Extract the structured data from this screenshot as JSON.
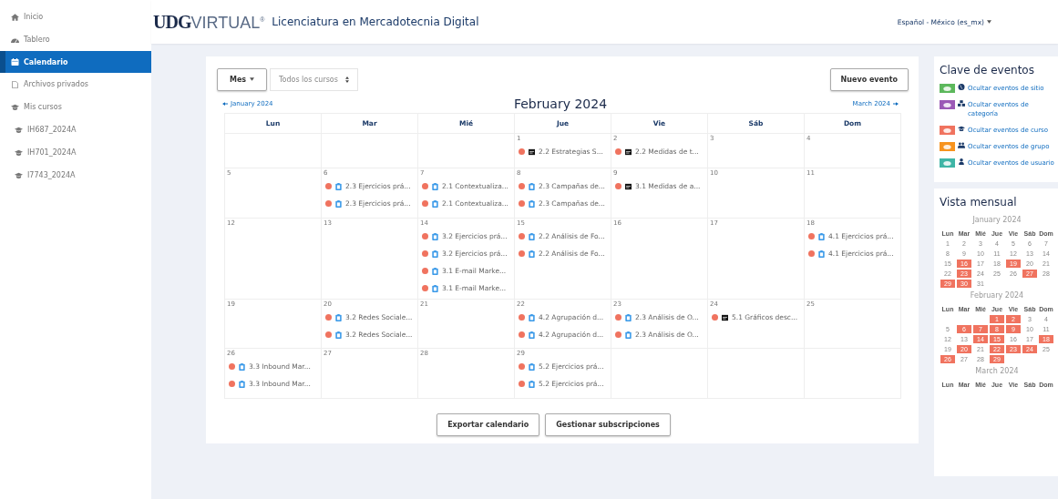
{
  "sidebar": {
    "items": [
      {
        "label": "Inicio",
        "selected": false
      },
      {
        "label": "Tablero",
        "selected": false
      },
      {
        "label": "Calendario",
        "selected": true
      },
      {
        "label": "Archivos privados",
        "selected": false
      },
      {
        "label": "Mis cursos",
        "selected": false,
        "children": [
          {
            "label": "IH687_2024A",
            "selected": false
          },
          {
            "label": "IH701_2024A",
            "selected": false
          },
          {
            "label": "I7743_2024A",
            "selected": false
          }
        ]
      }
    ]
  },
  "header": {
    "logo": "**UDG**VIRTUAL$^{®}$",
    "site_title": "Licenciatura en Mercadotecnia Digital",
    "language": "Español - México (es_mx)"
  },
  "calendar": {
    "view_button": "Mes",
    "course_filter": "Todos los cursos",
    "new_event_button": "Nuevo evento",
    "previous_month": "January 2024",
    "current_month": "February 2024",
    "next_month": "March 2024",
    "weekdays": [
      "Lun",
      "Mar",
      "Mié",
      "Jue",
      "Vie",
      "Sáb",
      "Dom"
    ],
    "weeks": [
      [
        {
          "kind": "blank"
        },
        {
          "kind": "blank"
        },
        {
          "kind": "blank"
        },
        {
          "kind": "day",
          "day": "1",
          "events": [
            {
              "kind": "quiz",
              "title": "2.2 Estrategias S..."
            }
          ]
        },
        {
          "kind": "day",
          "day": "2",
          "events": [
            {
              "kind": "quiz",
              "title": "2.2 Medidas de t..."
            }
          ]
        },
        {
          "kind": "day",
          "day": "3"
        },
        {
          "kind": "day",
          "day": "4"
        }
      ],
      [
        {
          "kind": "day",
          "day": "5"
        },
        {
          "kind": "day",
          "day": "6",
          "events": [
            {
              "kind": "assign",
              "title": "2.3 Ejercicios prá..."
            },
            {
              "kind": "assign",
              "title": "2.3 Ejercicios prá..."
            }
          ]
        },
        {
          "kind": "day",
          "day": "7",
          "events": [
            {
              "kind": "assign",
              "title": "2.1 Contextualiza..."
            },
            {
              "kind": "assign",
              "title": "2.1 Contextualiza..."
            }
          ]
        },
        {
          "kind": "day",
          "day": "8",
          "events": [
            {
              "kind": "assign",
              "title": "2.3 Campañas de..."
            },
            {
              "kind": "assign",
              "title": "2.3 Campañas de..."
            }
          ]
        },
        {
          "kind": "day",
          "day": "9",
          "events": [
            {
              "kind": "quiz",
              "title": "3.1 Medidas de a..."
            }
          ]
        },
        {
          "kind": "day",
          "day": "10"
        },
        {
          "kind": "day",
          "day": "11"
        }
      ],
      [
        {
          "kind": "day",
          "day": "12"
        },
        {
          "kind": "day",
          "day": "13"
        },
        {
          "kind": "day",
          "day": "14",
          "events": [
            {
              "kind": "assign",
              "title": "3.2 Ejercicios prá..."
            },
            {
              "kind": "assign",
              "title": "3.2 Ejercicios prá..."
            },
            {
              "kind": "assign",
              "title": "3.1 E-mail Marke..."
            },
            {
              "kind": "assign",
              "title": "3.1 E-mail Marke..."
            }
          ]
        },
        {
          "kind": "day",
          "day": "15",
          "events": [
            {
              "kind": "assign",
              "title": "2.2 Análisis de Fo..."
            },
            {
              "kind": "assign",
              "title": "2.2 Análisis de Fo..."
            }
          ]
        },
        {
          "kind": "day",
          "day": "16"
        },
        {
          "kind": "day",
          "day": "17"
        },
        {
          "kind": "day",
          "day": "18",
          "events": [
            {
              "kind": "assign",
              "title": "4.1 Ejercicios prá..."
            },
            {
              "kind": "assign",
              "title": "4.1 Ejercicios prá..."
            }
          ]
        }
      ],
      [
        {
          "kind": "day",
          "day": "19"
        },
        {
          "kind": "day",
          "day": "20",
          "events": [
            {
              "kind": "assign",
              "title": "3.2 Redes Sociale..."
            },
            {
              "kind": "assign",
              "title": "3.2 Redes Sociale..."
            }
          ]
        },
        {
          "kind": "day",
          "day": "21"
        },
        {
          "kind": "day",
          "day": "22",
          "events": [
            {
              "kind": "assign",
              "title": "4.2 Agrupación d..."
            },
            {
              "kind": "assign",
              "title": "4.2 Agrupación d..."
            }
          ]
        },
        {
          "kind": "day",
          "day": "23",
          "events": [
            {
              "kind": "assign",
              "title": "2.3 Análisis de O..."
            },
            {
              "kind": "assign",
              "title": "2.3 Análisis de O..."
            }
          ]
        },
        {
          "kind": "day",
          "day": "24",
          "events": [
            {
              "kind": "quiz",
              "title": "5.1 Gráficos desc..."
            }
          ]
        },
        {
          "kind": "day",
          "day": "25"
        }
      ],
      [
        {
          "kind": "day",
          "day": "26",
          "events": [
            {
              "kind": "assign",
              "title": "3.3 Inbound Mar..."
            },
            {
              "kind": "assign",
              "title": "3.3 Inbound Mar..."
            }
          ]
        },
        {
          "kind": "day",
          "day": "27"
        },
        {
          "kind": "day",
          "day": "28"
        },
        {
          "kind": "day",
          "day": "29",
          "events": [
            {
              "kind": "assign",
              "title": "5.2 Ejercicios prá..."
            },
            {
              "kind": "assign",
              "title": "5.2 Ejercicios prá..."
            }
          ]
        },
        {
          "kind": "blank"
        },
        {
          "kind": "blank"
        },
        {
          "kind": "blank"
        }
      ]
    ],
    "footer_buttons": [
      "Exportar calendario",
      "Gestionar subscripciones"
    ]
  },
  "event_key": {
    "title": "Clave de eventos",
    "items": [
      {
        "label": "Ocultar eventos de sitio",
        "color": "#5cb85c"
      },
      {
        "label": "Ocultar eventos de categoría",
        "color": "#9b59b6"
      },
      {
        "label": "Ocultar eventos de curso",
        "color": "#f0735f"
      },
      {
        "label": "Ocultar eventos de grupo",
        "color": "#f7931e"
      },
      {
        "label": "Ocultar eventos de usuario",
        "color": "#3fb5a6"
      }
    ]
  },
  "monthly_view": {
    "title": "Vista mensual",
    "months": [
      {
        "name": "January 2024",
        "weekdays": [
          "Lun",
          "Mar",
          "Mié",
          "Jue",
          "Vie",
          "Sáb",
          "Dom"
        ],
        "weeks": [
          [
            {
              "kind": "day",
              "day": "1",
              "event": false
            },
            {
              "kind": "day",
              "day": "2",
              "event": false
            },
            {
              "kind": "day",
              "day": "3",
              "event": false
            },
            {
              "kind": "day",
              "day": "4",
              "event": false
            },
            {
              "kind": "day",
              "day": "5",
              "event": false
            },
            {
              "kind": "day",
              "day": "6",
              "event": false
            },
            {
              "kind": "day",
              "day": "7",
              "event": false
            }
          ],
          [
            {
              "kind": "day",
              "day": "8",
              "event": false
            },
            {
              "kind": "day",
              "day": "9",
              "event": false
            },
            {
              "kind": "day",
              "day": "10",
              "event": false
            },
            {
              "kind": "day",
              "day": "11",
              "event": false
            },
            {
              "kind": "day",
              "day": "12",
              "event": false
            },
            {
              "kind": "day",
              "day": "13",
              "event": false
            },
            {
              "kind": "day",
              "day": "14",
              "event": false
            }
          ],
          [
            {
              "kind": "day",
              "day": "15",
              "event": false
            },
            {
              "kind": "day",
              "day": "16",
              "event": true
            },
            {
              "kind": "day",
              "day": "17",
              "event": false
            },
            {
              "kind": "day",
              "day": "18",
              "event": false
            },
            {
              "kind": "day",
              "day": "19",
              "event": true
            },
            {
              "kind": "day",
              "day": "20",
              "event": false
            },
            {
              "kind": "day",
              "day": "21",
              "event": false
            }
          ],
          [
            {
              "kind": "day",
              "day": "22",
              "event": false
            },
            {
              "kind": "day",
              "day": "23",
              "event": true
            },
            {
              "kind": "day",
              "day": "24",
              "event": false
            },
            {
              "kind": "day",
              "day": "25",
              "event": false
            },
            {
              "kind": "day",
              "day": "26",
              "event": false
            },
            {
              "kind": "day",
              "day": "27",
              "event": true
            },
            {
              "kind": "day",
              "day": "28",
              "event": false
            }
          ],
          [
            {
              "kind": "day",
              "day": "29",
              "event": true
            },
            {
              "kind": "day",
              "day": "30",
              "event": true
            },
            {
              "kind": "day",
              "day": "31",
              "event": false
            }
          ]
        ]
      },
      {
        "name": "February 2024",
        "weekdays": [
          "Lun",
          "Mar",
          "Mié",
          "Jue",
          "Vie",
          "Sáb",
          "Dom"
        ],
        "weeks": [
          [
            {
              "kind": "blank"
            },
            {
              "kind": "blank"
            },
            {
              "kind": "blank"
            },
            {
              "kind": "day",
              "day": "1",
              "event": true
            },
            {
              "kind": "day",
              "day": "2",
              "event": true
            },
            {
              "kind": "day",
              "day": "3",
              "event": false
            },
            {
              "kind": "day",
              "day": "4",
              "event": false
            }
          ],
          [
            {
              "kind": "day",
              "day": "5",
              "event": false
            },
            {
              "kind": "day",
              "day": "6",
              "event": true
            },
            {
              "kind": "day",
              "day": "7",
              "event": true
            },
            {
              "kind": "day",
              "day": "8",
              "event": true
            },
            {
              "kind": "day",
              "day": "9",
              "event": true
            },
            {
              "kind": "day",
              "day": "10",
              "event": false
            },
            {
              "kind": "day",
              "day": "11",
              "event": false
            }
          ],
          [
            {
              "kind": "day",
              "day": "12",
              "event": false
            },
            {
              "kind": "day",
              "day": "13",
              "event": false
            },
            {
              "kind": "day",
              "day": "14",
              "event": true
            },
            {
              "kind": "day",
              "day": "15",
              "event": true
            },
            {
              "kind": "day",
              "day": "16",
              "event": false
            },
            {
              "kind": "day",
              "day": "17",
              "event": false
            },
            {
              "kind": "day",
              "day": "18",
              "event": true
            }
          ],
          [
            {
              "kind": "day",
              "day": "19",
              "event": false
            },
            {
              "kind": "day",
              "day": "20",
              "event": true
            },
            {
              "kind": "day",
              "day": "21",
              "event": false
            },
            {
              "kind": "day",
              "day": "22",
              "event": true
            },
            {
              "kind": "day",
              "day": "23",
              "event": true
            },
            {
              "kind": "day",
              "day": "24",
              "event": true
            },
            {
              "kind": "day",
              "day": "25",
              "event": false
            }
          ],
          [
            {
              "kind": "day",
              "day": "26",
              "event": true
            },
            {
              "kind": "day",
              "day": "27",
              "event": false
            },
            {
              "kind": "day",
              "day": "28",
              "event": false
            },
            {
              "kind": "day",
              "day": "29",
              "event": true
            }
          ]
        ]
      },
      {
        "name": "March 2024",
        "weekdays": [
          "Lun",
          "Mar",
          "Mié",
          "Jue",
          "Vie",
          "Sáb",
          "Dom"
        ]
      }
    ]
  }
}
